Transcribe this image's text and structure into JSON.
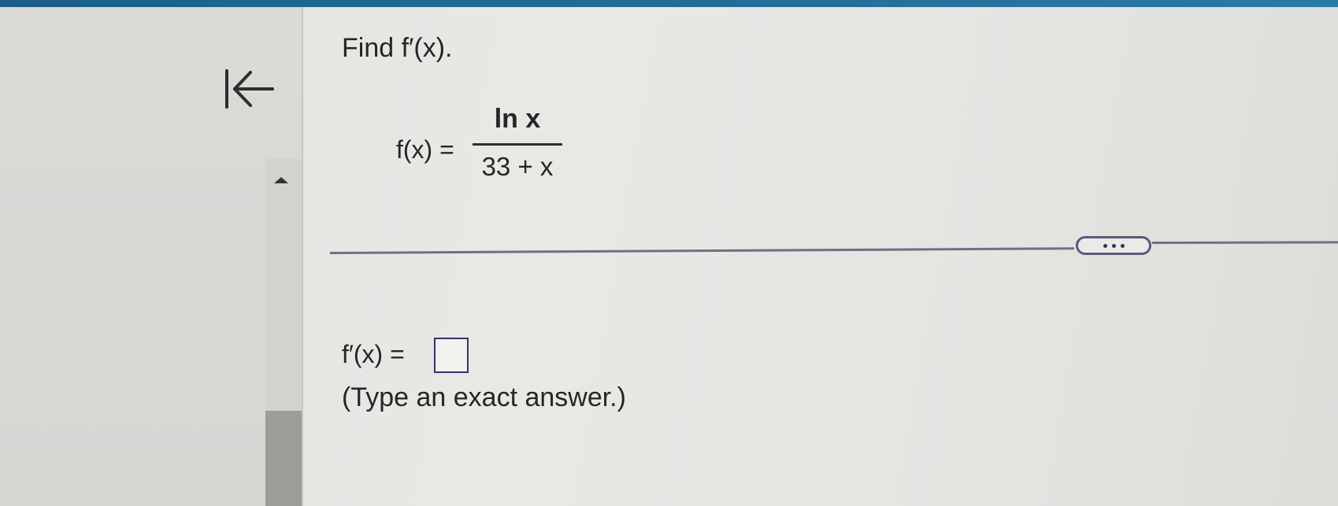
{
  "question": {
    "title": "Find f′(x).",
    "function_label": "f(x) =",
    "numerator": "ln x",
    "denominator": "33 + x"
  },
  "answer": {
    "label": "f′(x) =",
    "value": "",
    "instruction": "(Type an exact answer.)"
  },
  "icons": {
    "collapse": "collapse-left-arrow-icon",
    "scroll_up": "triangle-up-icon",
    "more": "ellipsis-icon"
  },
  "colors": {
    "top_strip": "#1b5f88",
    "separator": "#6f6f86",
    "input_border": "#34346e",
    "text": "#262626"
  }
}
